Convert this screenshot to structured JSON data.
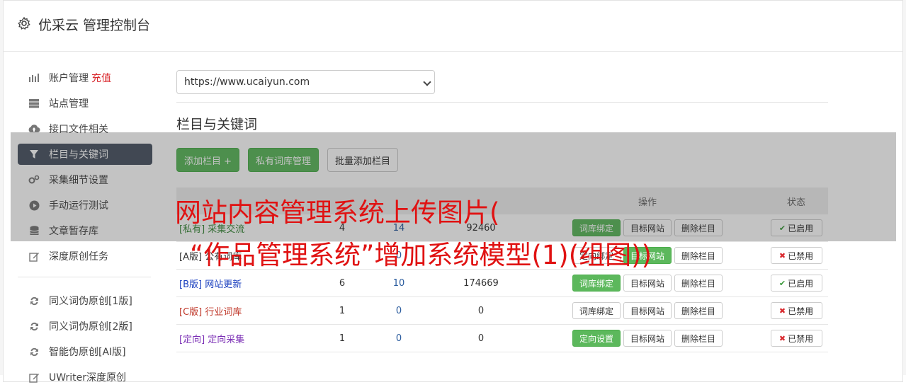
{
  "header": {
    "title": "优采云 管理控制台",
    "icon": "gear-icon"
  },
  "sidebar": {
    "items": [
      {
        "label": "账户管理",
        "extra": "充值",
        "icon": "bar-chart-icon"
      },
      {
        "label": "站点管理",
        "icon": "server-icon"
      },
      {
        "label": "接口文件相关",
        "icon": "cloud-upload-icon"
      },
      {
        "label": "栏目与关键词",
        "icon": "filter-icon",
        "active": true
      },
      {
        "label": "采集细节设置",
        "icon": "cogs-icon"
      },
      {
        "label": "手动运行测试",
        "icon": "play-circle-icon"
      },
      {
        "label": "文章暂存库",
        "icon": "database-icon"
      },
      {
        "label": "深度原创任务",
        "icon": "edit-icon"
      }
    ],
    "items2": [
      {
        "label": "同义词伪原创[1版]",
        "icon": "refresh-icon"
      },
      {
        "label": "同义词伪原创[2版]",
        "icon": "refresh-icon"
      },
      {
        "label": "智能伪原创[AI版]",
        "icon": "refresh-icon"
      },
      {
        "label": "UWriter深度原创",
        "icon": "edit-icon"
      }
    ]
  },
  "site_select": {
    "value": "https://www.ucaiyun.com"
  },
  "section": {
    "title": "栏目与关键词"
  },
  "buttons": {
    "add_column": "添加栏目 +",
    "private_lib": "私有词库管理",
    "batch_add": "批量添加栏目"
  },
  "table": {
    "headers": {
      "ops": "操作",
      "status": "状态"
    },
    "rows": [
      {
        "tag": "[私有]",
        "name": "采集交流",
        "a": "4",
        "b": "14",
        "c": "92460",
        "tag_color": "#3c8a3c",
        "ops": [
          "词库绑定",
          "目标网站",
          "删除栏目"
        ],
        "ops_green": [
          true,
          false,
          false
        ],
        "status": "已启用",
        "on": true
      },
      {
        "tag": "[A版]",
        "name": "公有词库",
        "a": "",
        "b": "0",
        "c": "",
        "tag_color": "#333333",
        "ops": [
          "定向绑定",
          "目标网站",
          "删除栏目"
        ],
        "ops_green": [
          false,
          true,
          false
        ],
        "status": "已禁用",
        "on": false
      },
      {
        "tag": "[B版]",
        "name": "网站更新",
        "a": "6",
        "b": "10",
        "c": "174669",
        "tag_color": "#1a3fbf",
        "ops": [
          "词库绑定",
          "目标网站",
          "删除栏目"
        ],
        "ops_green": [
          true,
          false,
          false
        ],
        "status": "已启用",
        "on": true
      },
      {
        "tag": "[C版]",
        "name": "行业词库",
        "a": "1",
        "b": "0",
        "c": "0",
        "tag_color": "#c0392b",
        "ops": [
          "词库绑定",
          "目标网站",
          "删除栏目"
        ],
        "ops_green": [
          false,
          false,
          false
        ],
        "status": "已禁用",
        "on": false
      },
      {
        "tag": "[定向]",
        "name": "定向采集",
        "a": "1",
        "b": "0",
        "c": "0",
        "tag_color": "#7b2fb5",
        "ops": [
          "定向设置",
          "目标网站",
          "删除栏目"
        ],
        "ops_green": [
          true,
          false,
          false
        ],
        "status": "已禁用",
        "on": false
      }
    ]
  },
  "overlay": {
    "line1": "网站内容管理系统上传图片(",
    "line2": "“作品管理系统”增加系统模型(1)(组图))"
  }
}
